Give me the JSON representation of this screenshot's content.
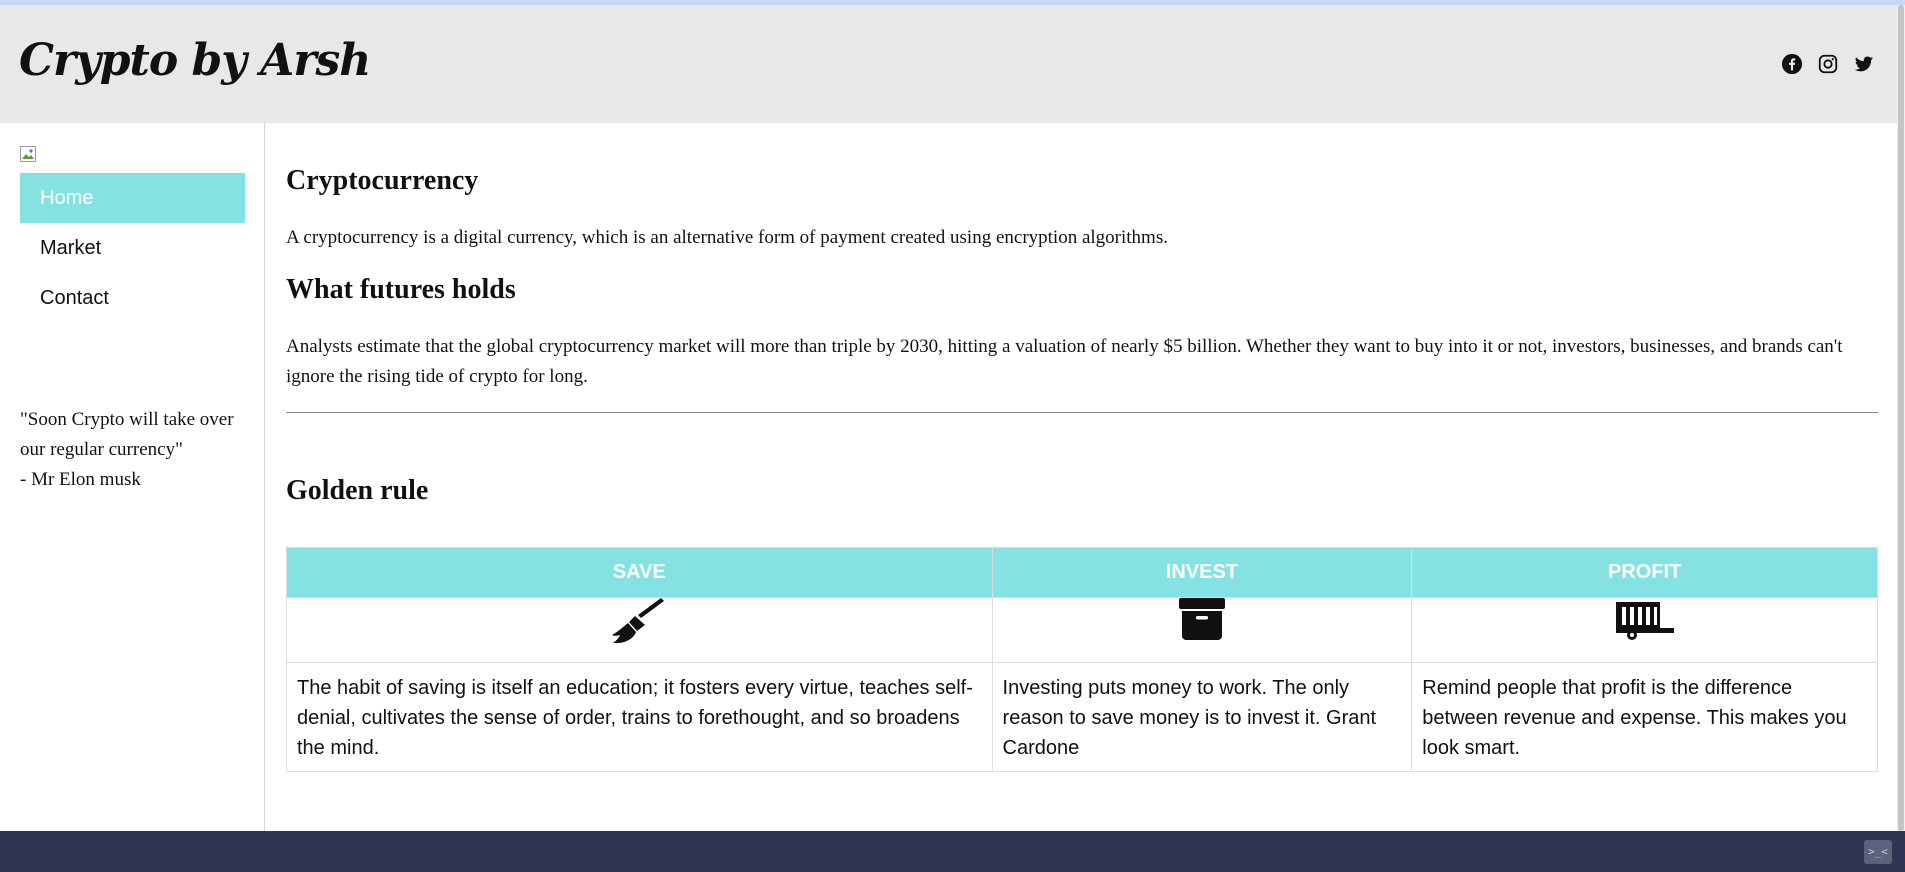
{
  "header": {
    "brand": "Crypto by Arsh",
    "social_icons": [
      "facebook-icon",
      "instagram-icon",
      "twitter-icon"
    ]
  },
  "sidebar": {
    "nav": [
      {
        "label": "Home",
        "active": true
      },
      {
        "label": "Market",
        "active": false
      },
      {
        "label": "Contact",
        "active": false
      }
    ],
    "quote": {
      "line1": "\"Soon Crypto will take over our regular currency\"",
      "line2": "- Mr Elon musk"
    }
  },
  "main": {
    "section1": {
      "title": "Cryptocurrency",
      "body": "A cryptocurrency is a digital currency, which is an alternative form of payment created using encryption algorithms."
    },
    "section2": {
      "title": "What futures holds",
      "body": "Analysts estimate that the global cryptocurrency market will more than triple by 2030, hitting a valuation of nearly $5 billion. Whether they want to buy into it or not, investors, businesses, and brands can't ignore the rising tide of crypto for long."
    },
    "section3": {
      "title": "Golden rule"
    },
    "rules_table": {
      "columns": [
        {
          "header": "SAVE",
          "icon": "broom-icon",
          "text": "The habit of saving is itself an education; it fosters every virtue, teaches self-denial, cultivates the sense of order, trains to forethought, and so broadens the mind."
        },
        {
          "header": "INVEST",
          "icon": "archive-box-icon",
          "text": "Investing puts money to work. The only reason to save money is to invest it. Grant Cardone"
        },
        {
          "header": "PROFIT",
          "icon": "trailer-icon",
          "text": "Remind people that profit is the difference between revenue and expense. This makes you look smart."
        }
      ]
    }
  },
  "footer": {
    "corner_glyph": ">_<"
  },
  "colors": {
    "accent": "#84e3e2",
    "header_bg": "#e8e8e8",
    "footer_bg": "#2e3552"
  }
}
